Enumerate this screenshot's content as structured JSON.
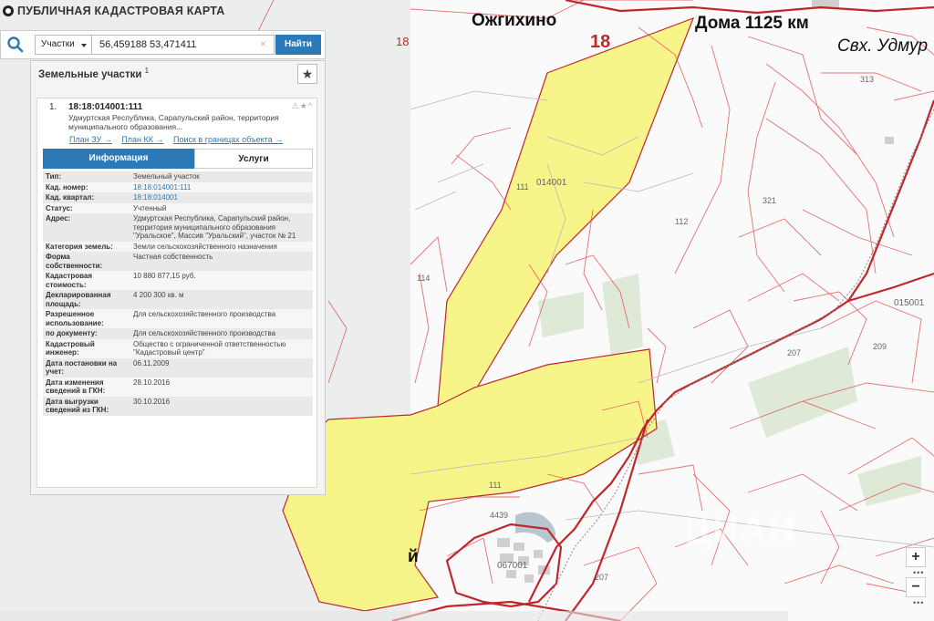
{
  "header": {
    "title": "ПУБЛИЧНАЯ КАДАСТРОВАЯ КАРТА"
  },
  "search": {
    "type_label": "Участки",
    "query": "56,459188 53,471411",
    "clear_label": "×",
    "find_label": "Найти"
  },
  "panel": {
    "title": "Земельные участки",
    "count": "1",
    "star": "★"
  },
  "card": {
    "number": "1.",
    "cad_number": "18:18:014001:111",
    "address_short": "Удмуртская Республика, Сарапульский район, территория муниципального образования...",
    "icons": "⚠★^",
    "links": [
      {
        "label": "План ЗУ →"
      },
      {
        "label": "План КК →"
      },
      {
        "label": "Поиск в границах объекта →"
      }
    ],
    "tabs": [
      {
        "label": "Информация"
      },
      {
        "label": "Услуги"
      }
    ],
    "rows": [
      {
        "key": "Тип:",
        "value": "Земельный участок"
      },
      {
        "key": "Кад. номер:",
        "value": "18:18:014001:111"
      },
      {
        "key": "Кад. квартал:",
        "value": "18:18:014001"
      },
      {
        "key": "Статус:",
        "value": "Учтенный"
      },
      {
        "key": "Адрес:",
        "value": "Удмуртская Республика, Сарапульский район, территория муниципального образования \"Уральское\", Массив \"Уральский\", участок № 21"
      },
      {
        "key": "Категория земель:",
        "value": "Земли сельскохозяйственного назначения"
      },
      {
        "key": "Форма собственности:",
        "value": "Частная собственность"
      },
      {
        "key": "Кадастровая стоимость:",
        "value": "10 880 877,15 руб."
      },
      {
        "key": "Декларированная площадь:",
        "value": "4 200 300 кв. м"
      },
      {
        "key": "Разрешенное использование:",
        "value": "Для сельскохозяйственного производства"
      },
      {
        "key": "по документу:",
        "value": "Для сельскохозяйственного производства"
      },
      {
        "key": "Кадастровый инженер:",
        "value": "Общество с ограниченной ответственностью \"Кадастровый центр\""
      },
      {
        "key": "Дата постановки на учет:",
        "value": "06.11.2009"
      },
      {
        "key": "Дата изменения сведений в ГКН:",
        "value": "28.10.2016"
      },
      {
        "key": "Дата выгрузки сведений из ГКН:",
        "value": "30.10.2016"
      }
    ]
  },
  "map": {
    "labels": {
      "town1": "Ожгихино",
      "town2": "Дома 1125 км",
      "town3": "Свх. Удмур",
      "region1": "18",
      "region2": "18",
      "q1": "014001",
      "q2": "015001",
      "q3": "067001",
      "p111a": "111",
      "p111b": "111",
      "p112": "112",
      "p114": "114",
      "p313": "313",
      "p321": "321",
      "p207a": "207",
      "p207b": "207",
      "p209": "209",
      "p4439": "4439",
      "frag": "й"
    }
  },
  "zoom": {
    "in": "+",
    "out": "−",
    "dots1": "•••",
    "dots2": "•••"
  },
  "watermark": "ЦИАН",
  "colors": {
    "accent": "#2c79b8",
    "parcel": "#f7f48a",
    "boundary": "#c0272d"
  }
}
